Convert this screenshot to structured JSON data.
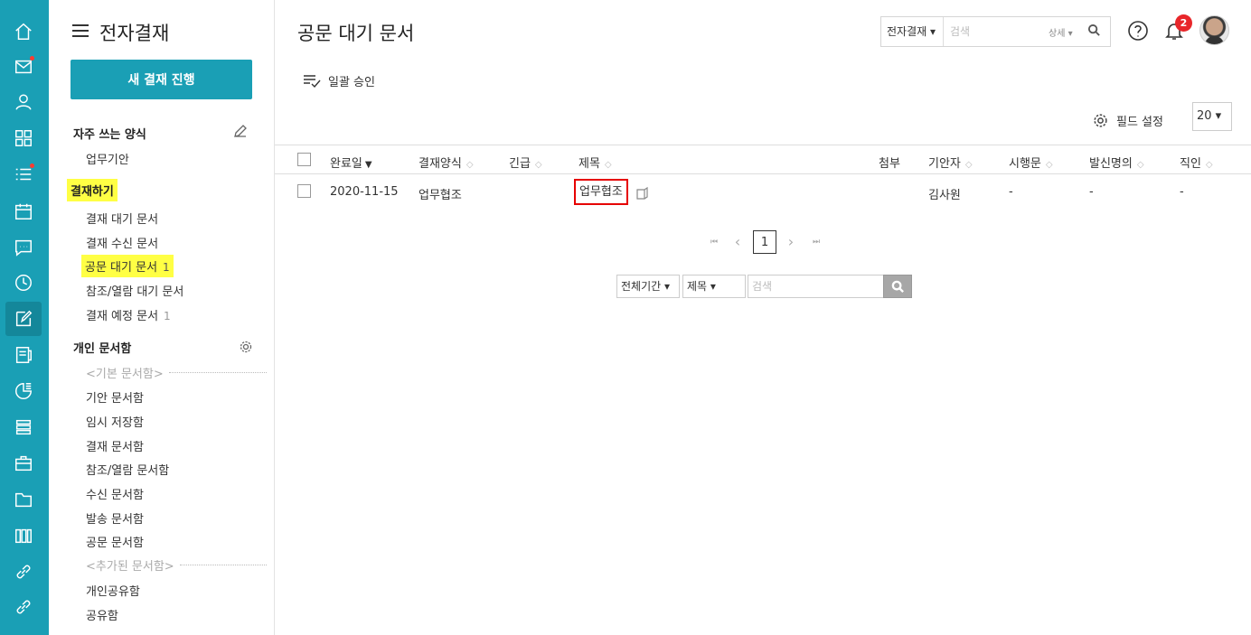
{
  "rail": {
    "icons": [
      "home-icon",
      "mail-icon",
      "person-icon",
      "grid-icon",
      "list-icon",
      "calendar-icon",
      "chat-icon",
      "clock-icon",
      "approval-icon",
      "board-icon",
      "report-icon",
      "stack-icon",
      "briefcase-icon",
      "folder-icon",
      "library-icon",
      "link-icon",
      "link-icon-2"
    ],
    "accent_color": "#1a9fb5"
  },
  "sidebar": {
    "title": "전자결재",
    "new_button": "새 결재 진행",
    "favorites": {
      "title": "자주 쓰는 양식",
      "items": [
        "업무기안"
      ]
    },
    "approval": {
      "title": "결재하기",
      "items": [
        {
          "label": "결재 대기 문서",
          "count": ""
        },
        {
          "label": "결재 수신 문서",
          "count": ""
        },
        {
          "label": "공문 대기 문서",
          "count": "1"
        },
        {
          "label": "참조/열람 대기 문서",
          "count": ""
        },
        {
          "label": "결재 예정 문서",
          "count": "1"
        }
      ]
    },
    "personal": {
      "title": "개인 문서함",
      "basic_head": "<기본 문서함>",
      "basic_items": [
        "기안 문서함",
        "임시 저장함",
        "결재 문서함",
        "참조/열람 문서함",
        "수신 문서함",
        "발송 문서함",
        "공문 문서함"
      ],
      "added_head": "<추가된 문서함>",
      "added_items": [
        "개인공유함",
        "공유함"
      ]
    }
  },
  "header": {
    "page_title": "공문 대기 문서",
    "search_scope": "전자결재 ▾",
    "search_placeholder": "검색",
    "search_detail": "상세 ▾",
    "notification_count": "2"
  },
  "toolbar": {
    "bulk_approve": "일괄 승인",
    "field_settings": "필드 설정",
    "page_size": "20 ▾"
  },
  "table": {
    "columns": [
      "완료일",
      "결재양식",
      "긴급",
      "제목",
      "첨부",
      "기안자",
      "시행문",
      "발신명의",
      "직인"
    ],
    "rows": [
      {
        "date": "2020-11-15",
        "form": "업무협조",
        "urgent": "",
        "title": "업무협조",
        "attach": "",
        "drafter": "김사원",
        "enforce": "-",
        "sender": "-",
        "seal": "-"
      }
    ]
  },
  "pagination": {
    "first": "⏮",
    "prev": "‹",
    "current": "1",
    "next": "›",
    "last": "⏭"
  },
  "bottom_search": {
    "period": "전체기간 ▾",
    "field": "제목 ▾",
    "placeholder": "검색"
  }
}
